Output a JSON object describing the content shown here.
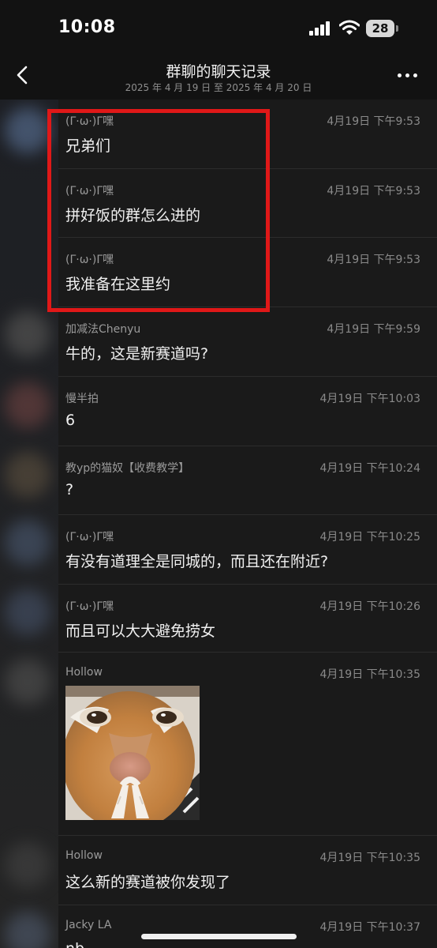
{
  "status_bar": {
    "time": "10:08",
    "battery": "28"
  },
  "nav": {
    "title": "群聊的聊天记录",
    "subtitle": "2025 年 4 月 19 日 至 2025 年 4 月 20 日"
  },
  "messages": [
    {
      "sender": "(Γ·ω·)Γ嘿",
      "time": "4月19日 下午9:53",
      "text": "兄弟们"
    },
    {
      "sender": "(Γ·ω·)Γ嘿",
      "time": "4月19日 下午9:53",
      "text": "拼好饭的群怎么进的"
    },
    {
      "sender": "(Γ·ω·)Γ嘿",
      "time": "4月19日 下午9:53",
      "text": "我准备在这里约"
    },
    {
      "sender": "加减法Chenyu",
      "time": "4月19日 下午9:59",
      "text": "牛的，这是新赛道吗?"
    },
    {
      "sender": "慢半拍",
      "time": "4月19日 下午10:03",
      "text": "6"
    },
    {
      "sender": "教yp的猫奴【收费教学】",
      "time": "4月19日 下午10:24",
      "text": "?"
    },
    {
      "sender": "(Γ·ω·)Γ嘿",
      "time": "4月19日 下午10:25",
      "text": "有没有道理全是同城的，而且还在附近?"
    },
    {
      "sender": "(Γ·ω·)Γ嘿",
      "time": "4月19日 下午10:26",
      "text": "而且可以大大避免捞女"
    },
    {
      "sender": "Hollow",
      "time": "4月19日 下午10:35",
      "image": "cat-sticker"
    },
    {
      "sender": "Hollow",
      "time": "4月19日 下午10:35",
      "text": "这么新的赛道被你发现了"
    },
    {
      "sender": "Jacky LA",
      "time": "4月19日 下午10:37",
      "text": "nb"
    }
  ],
  "colors": {
    "highlight": "#e01818",
    "background": "#1a1a1a"
  }
}
